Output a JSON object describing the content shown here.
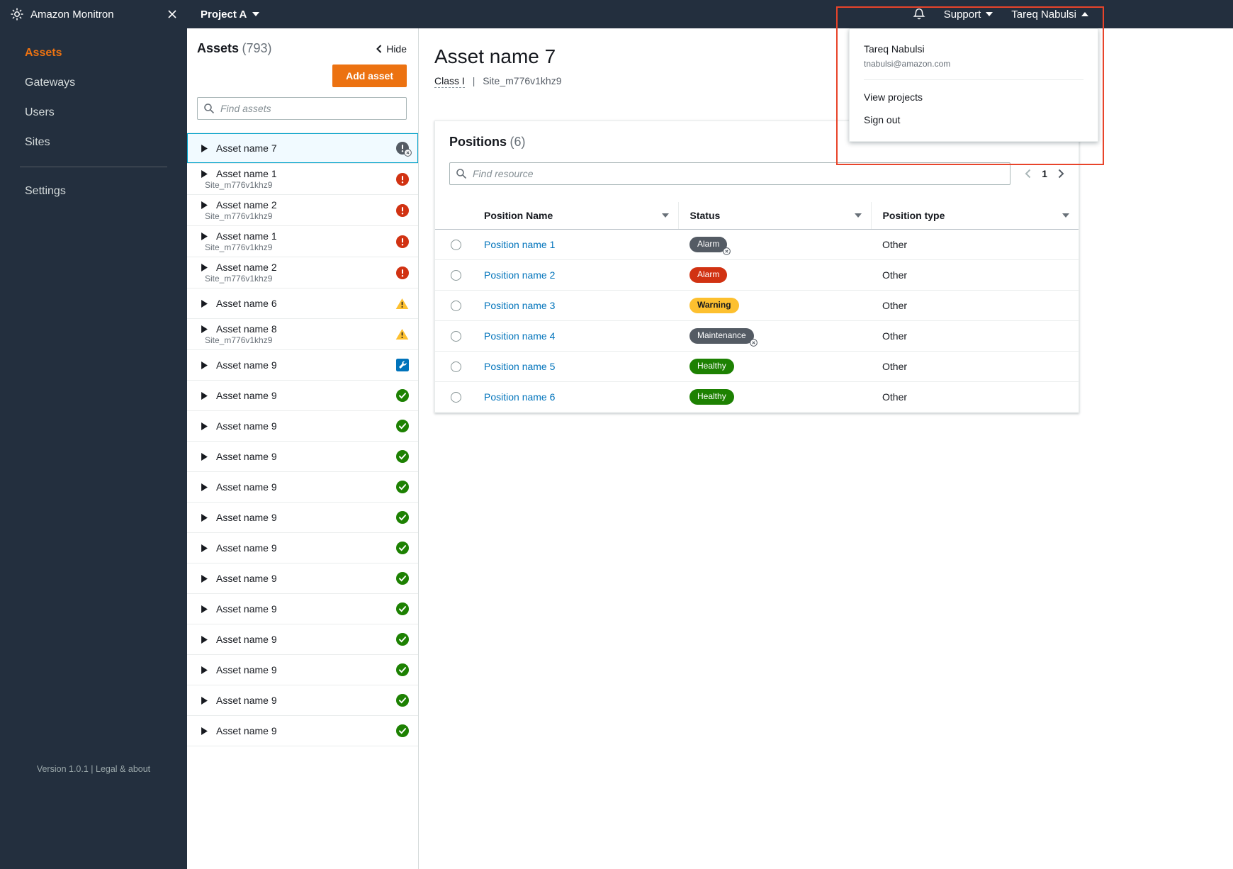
{
  "colors": {
    "topbar_bg": "#232f3e",
    "accent_orange": "#ec7211",
    "link_blue": "#0073bb",
    "selected_border": "#00a1c9",
    "selected_bg": "#f1faff",
    "alarm_red": "#d13212",
    "warning_yellow": "#fdc02f",
    "healthy_green": "#1d8102",
    "maintenance_gray": "#545b64",
    "annotation_red": "#e8442a"
  },
  "topbar": {
    "app_name": "Amazon Monitron",
    "project": "Project A",
    "support": "Support",
    "user": "Tareq Nabulsi"
  },
  "sidebar": {
    "items": [
      {
        "label": "Assets"
      },
      {
        "label": "Gateways"
      },
      {
        "label": "Users"
      },
      {
        "label": "Sites"
      },
      {
        "label": "Settings"
      }
    ],
    "version": "Version 1.0.1 |",
    "legal": "Legal & about"
  },
  "assets_panel": {
    "title": "Assets",
    "count": "(793)",
    "hide": "Hide",
    "add_button": "Add asset",
    "search_placeholder": "Find assets",
    "items": [
      {
        "name": "Asset name 7",
        "site": "",
        "cls": "ack selected"
      },
      {
        "name": "Asset name 1",
        "site": "Site_m776v1khz9",
        "cls": "alarm"
      },
      {
        "name": "Asset name 2",
        "site": "Site_m776v1khz9",
        "cls": "alarm"
      },
      {
        "name": "Asset name 1",
        "site": "Site_m776v1khz9",
        "cls": "alarm"
      },
      {
        "name": "Asset name 2",
        "site": "Site_m776v1khz9",
        "cls": "alarm"
      },
      {
        "name": "Asset name 6",
        "site": "",
        "cls": "warning"
      },
      {
        "name": "Asset name 8",
        "site": "Site_m776v1khz9",
        "cls": "warning"
      },
      {
        "name": "Asset name 9",
        "site": "",
        "cls": "wrench"
      },
      {
        "name": "Asset name 9",
        "site": "",
        "cls": "healthy"
      },
      {
        "name": "Asset name 9",
        "site": "",
        "cls": "healthy"
      },
      {
        "name": "Asset name 9",
        "site": "",
        "cls": "healthy"
      },
      {
        "name": "Asset name 9",
        "site": "",
        "cls": "healthy"
      },
      {
        "name": "Asset name 9",
        "site": "",
        "cls": "healthy"
      },
      {
        "name": "Asset name 9",
        "site": "",
        "cls": "healthy"
      },
      {
        "name": "Asset name 9",
        "site": "",
        "cls": "healthy"
      },
      {
        "name": "Asset name 9",
        "site": "",
        "cls": "healthy"
      },
      {
        "name": "Asset name 9",
        "site": "",
        "cls": "healthy"
      },
      {
        "name": "Asset name 9",
        "site": "",
        "cls": "healthy"
      },
      {
        "name": "Asset name 9",
        "site": "",
        "cls": "healthy"
      },
      {
        "name": "Asset name 9",
        "site": "",
        "cls": "healthy"
      }
    ]
  },
  "main": {
    "title": "Asset name 7",
    "breadcrumb": {
      "class_label": "Class I",
      "separator": "|",
      "site": "Site_m776v1khz9"
    },
    "positions": {
      "title": "Positions",
      "count": "(6)",
      "search_placeholder": "Find resource",
      "page": "1",
      "columns": [
        {
          "label": "Position Name"
        },
        {
          "label": "Status"
        },
        {
          "label": "Position type"
        }
      ],
      "rows": [
        {
          "name": "Position name 1",
          "status_label": "Alarm",
          "status_class": "alarm-ack",
          "type": "Other"
        },
        {
          "name": "Position name 2",
          "status_label": "Alarm",
          "status_class": "alarm",
          "type": "Other"
        },
        {
          "name": "Position name 3",
          "status_label": "Warning",
          "status_class": "warning",
          "type": "Other"
        },
        {
          "name": "Position name 4",
          "status_label": "Maintenance",
          "status_class": "maintenance-ack",
          "type": "Other"
        },
        {
          "name": "Position name 5",
          "status_label": "Healthy",
          "status_class": "healthy",
          "type": "Other"
        },
        {
          "name": "Position name 6",
          "status_label": "Healthy",
          "status_class": "healthy",
          "type": "Other"
        }
      ]
    }
  },
  "user_menu": {
    "name": "Tareq Nabulsi",
    "email": "tnabulsi@amazon.com",
    "items": [
      {
        "label": "View projects"
      },
      {
        "label": "Sign out"
      }
    ]
  }
}
